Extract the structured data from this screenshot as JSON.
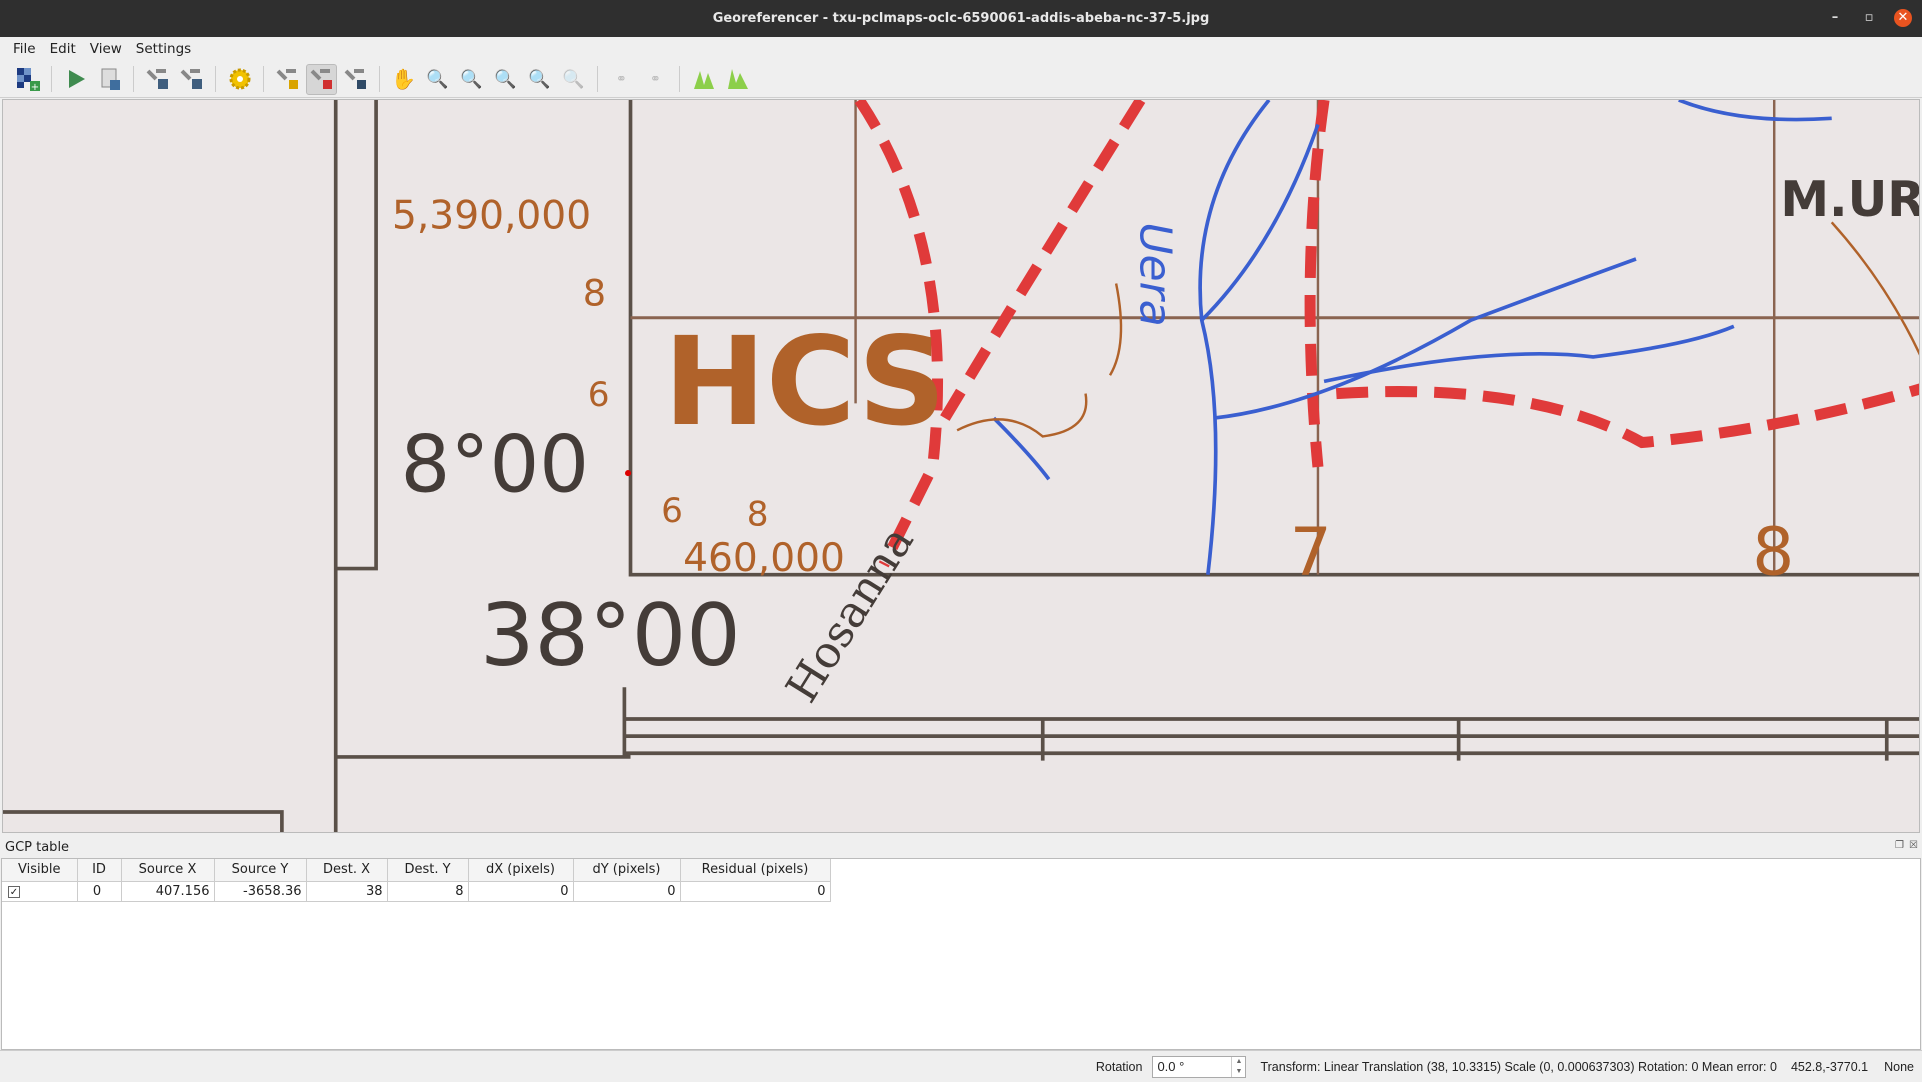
{
  "window": {
    "title": "Georeferencer - txu-pclmaps-oclc-6590061-addis-abeba-nc-37-5.jpg"
  },
  "menu": [
    "File",
    "Edit",
    "View",
    "Settings"
  ],
  "toolbar": [
    "open-raster",
    "start-georeferencing",
    "generate-gdal-script",
    "load-gcp-points",
    "save-gcp-points",
    "transformation-settings",
    "add-point",
    "delete-point",
    "move-gcp-point",
    "pan",
    "zoom-in",
    "zoom-out",
    "zoom-to-layer",
    "zoom-last",
    "zoom-next",
    "link-georeferencer-to-qgis",
    "link-qgis-to-georeferencer",
    "full-histogram-stretch",
    "local-histogram-stretch"
  ],
  "map": {
    "labels": [
      "5,390,000",
      "8",
      "6",
      "8°00",
      "HCS",
      "Uera",
      "M.UR",
      "6",
      "8",
      "460,000",
      "7",
      "8",
      "38°00",
      "Hosanna"
    ]
  },
  "gcp": {
    "title": "GCP table",
    "columns": [
      "Visible",
      "ID",
      "Source X",
      "Source Y",
      "Dest. X",
      "Dest. Y",
      "dX (pixels)",
      "dY (pixels)",
      "Residual (pixels)"
    ],
    "rows": [
      {
        "visible": true,
        "id": "0",
        "source_x": "407.156",
        "source_y": "-3658.36",
        "dest_x": "38",
        "dest_y": "8",
        "dx": "0",
        "dy": "0",
        "residual": "0"
      }
    ]
  },
  "status": {
    "rotation_label": "Rotation",
    "rotation_value": "0.0 °",
    "transform": "Transform: Linear Translation (38, 10.3315) Scale (0, 0.000637303) Rotation: 0 Mean error: 0",
    "coords": "452.8,-3770.1",
    "crs": "None"
  },
  "colors": {
    "accent": "#e95420",
    "grid": "#5a5048",
    "label": "#b0622a",
    "road": "#e03a3a",
    "river": "#3a5fd0"
  }
}
